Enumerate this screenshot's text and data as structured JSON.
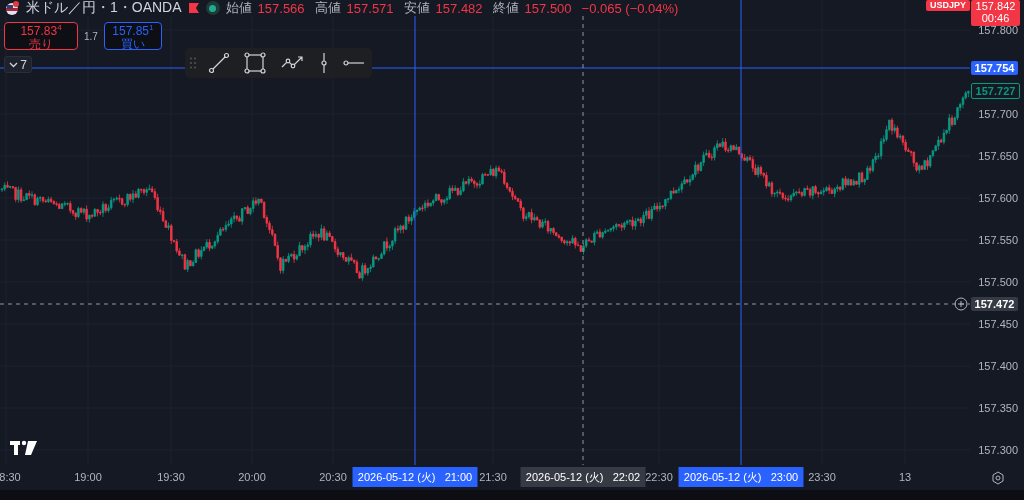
{
  "header": {
    "title": "米ドル／円・1・OANDA",
    "market_open": true,
    "ohlc": [
      {
        "label": "始値",
        "value": "157.566"
      },
      {
        "label": "高値",
        "value": "157.571"
      },
      {
        "label": "安値",
        "value": "157.482"
      },
      {
        "label": "終値",
        "value": "157.500"
      }
    ],
    "change": "−0.065 (−0.04%)"
  },
  "trade": {
    "sell": {
      "price": "157.83$^{4}$",
      "label": "売り"
    },
    "spread": "1.7",
    "buy": {
      "price": "157.85$^{1}$",
      "label": "買い"
    }
  },
  "indicators_toggle": {
    "count": "7",
    "expanded": false
  },
  "drawing_toolbar": [
    {
      "kind": "trend-line"
    },
    {
      "kind": "rectangle"
    },
    {
      "kind": "path"
    },
    {
      "kind": "vertical-line"
    },
    {
      "kind": "ray"
    }
  ],
  "price_axis": {
    "ticks": [
      "157.800",
      "157.700",
      "157.650",
      "157.600",
      "157.550",
      "157.500",
      "157.450",
      "157.400",
      "157.350",
      "157.300"
    ],
    "symbol": "USDJPY",
    "last_price": "157.842",
    "countdown": "00:46",
    "markers": [
      {
        "kind": "line",
        "value": "157.754"
      },
      {
        "kind": "last",
        "value": "157.727"
      },
      {
        "kind": "cursor",
        "value": "157.472"
      }
    ]
  },
  "time_axis": {
    "ticks": [
      "8:30",
      "19:00",
      "19:30",
      "20:00",
      "20:30",
      "21:30",
      "22:30",
      "23:30",
      "13"
    ],
    "markers": [
      {
        "kind": "pinned",
        "date": "2026-05-12 (火)",
        "time": "21:00"
      },
      {
        "kind": "cursor",
        "date": "2026-05-12 (火)",
        "time": "22:02"
      },
      {
        "kind": "pinned",
        "date": "2026-05-12 (火)",
        "time": "23:00"
      }
    ]
  }
}
